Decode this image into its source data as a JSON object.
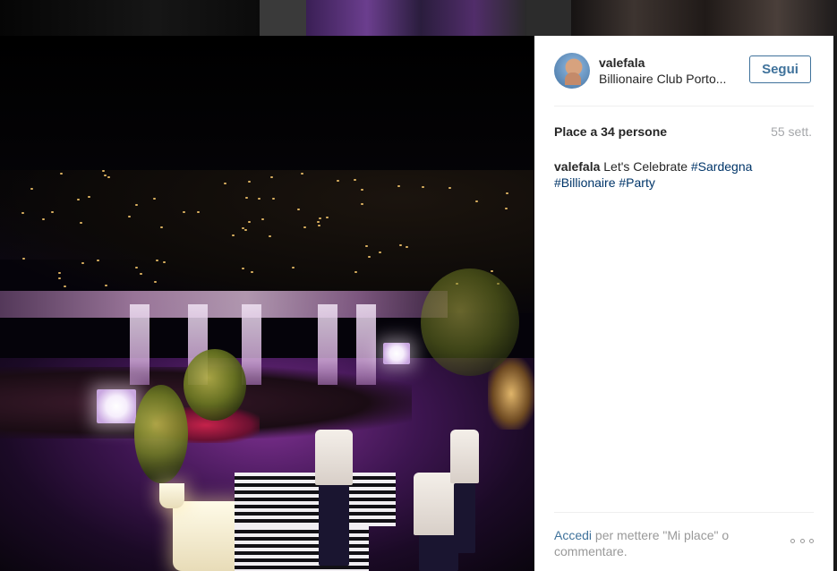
{
  "post": {
    "username": "valefala",
    "location": "Billionaire Club Porto...",
    "follow_label": "Segui",
    "likes_text": "Place a 34 persone",
    "timestamp": "55 sett.",
    "caption": {
      "username": "valefala",
      "text": "Let's Celebrate",
      "hashtags": [
        "#Sardegna",
        "#Billionaire",
        "#Party"
      ]
    }
  },
  "footer": {
    "login_label": "Accedi",
    "login_suffix": "per mettere \"Mi place\" o commentare."
  },
  "colors": {
    "link_blue": "#3f729b",
    "hashtag_blue": "#003569",
    "muted_gray": "#a5a7aa"
  },
  "icons": {
    "avatar": "user-avatar",
    "more": "more-options-icon"
  }
}
